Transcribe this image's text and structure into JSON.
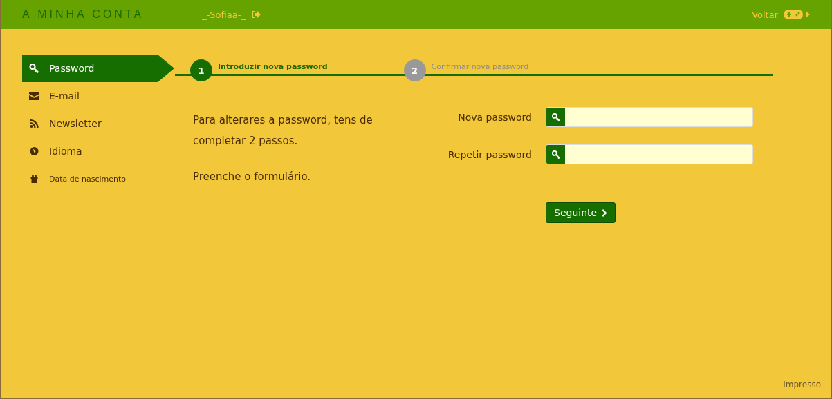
{
  "header": {
    "title": "A MINHA CONTA",
    "user": "_-Sofiaa-_",
    "back": "Voltar"
  },
  "sidebar": {
    "items": [
      {
        "label": "Password",
        "selected": true
      },
      {
        "label": "E-mail",
        "selected": false
      },
      {
        "label": "Newsletter",
        "selected": false
      },
      {
        "label": "Idioma",
        "selected": false
      },
      {
        "label": "Data de nascimento",
        "selected": false
      }
    ]
  },
  "steps": [
    {
      "number": "1",
      "label": "Introduzir nova password",
      "selected": true
    },
    {
      "number": "2",
      "label": "Confirmar nova password",
      "selected": false
    }
  ],
  "intro": [
    "Para alterares a password, tens de completar 2 passos.",
    "Preenche o formulário."
  ],
  "fields": [
    {
      "label": "Nova password"
    },
    {
      "label": "Repetir password"
    }
  ],
  "next_button": "Seguinte",
  "footer": "Impresso"
}
